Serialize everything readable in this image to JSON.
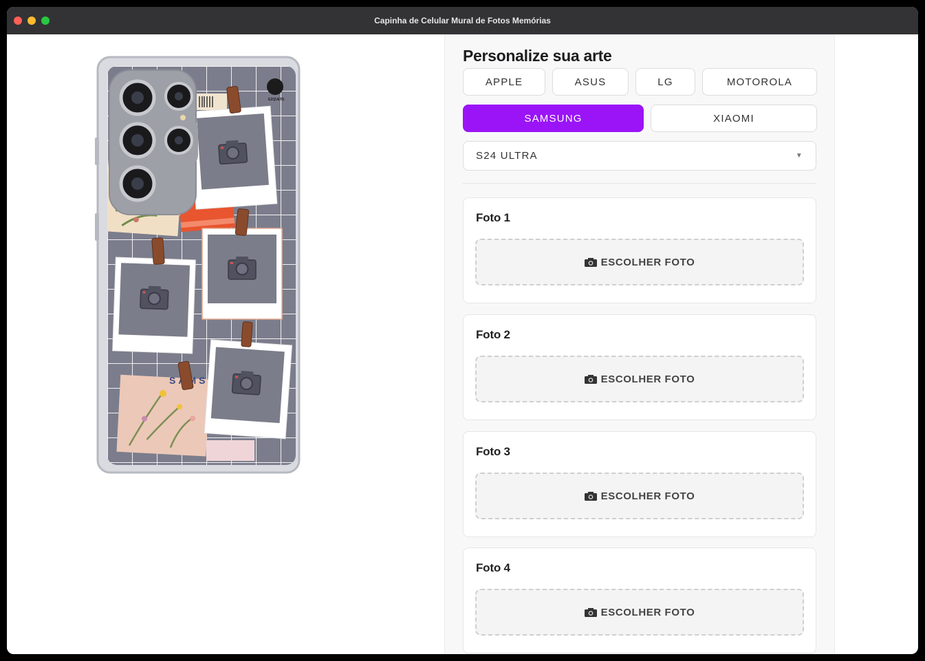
{
  "window": {
    "title": "Capinha de Celular Mural de Fotos Memórias"
  },
  "phone": {
    "brand_text": "SAMSUNG",
    "logo_text": "EZQUETE"
  },
  "panel": {
    "heading": "Personalize sua arte",
    "brands": [
      {
        "label": "APPLE",
        "active": false
      },
      {
        "label": "ASUS",
        "active": false
      },
      {
        "label": "LG",
        "active": false
      },
      {
        "label": "MOTOROLA",
        "active": false
      },
      {
        "label": "SAMSUNG",
        "active": true
      },
      {
        "label": "XIAOMI",
        "active": false
      }
    ],
    "model_select": {
      "value": "S24 ULTRA"
    },
    "photos": [
      {
        "title": "Foto 1",
        "button": "ESCOLHER FOTO"
      },
      {
        "title": "Foto 2",
        "button": "ESCOLHER FOTO"
      },
      {
        "title": "Foto 3",
        "button": "ESCOLHER FOTO"
      },
      {
        "title": "Foto 4",
        "button": "ESCOLHER FOTO"
      }
    ]
  },
  "colors": {
    "accent": "#9b14f7",
    "case_grid": "#7b7d8c",
    "photo_placeholder": "#7c7d8a"
  }
}
